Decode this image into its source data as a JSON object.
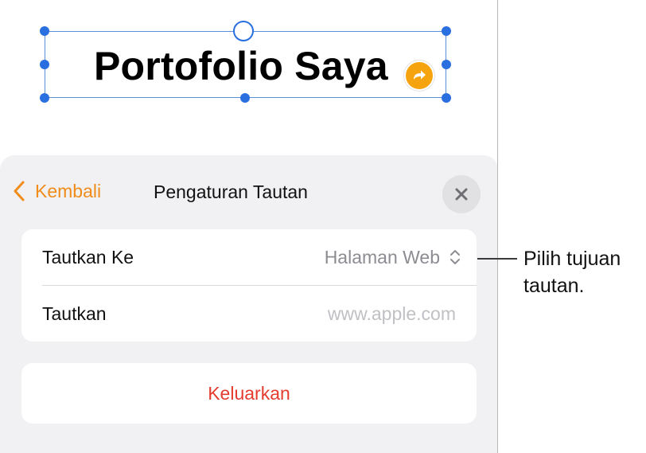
{
  "canvas": {
    "title": "Portofolio Saya",
    "link_badge_icon": "link-arrow-icon",
    "selection_color": "#2a6fe0",
    "badge_color": "#f5a30e"
  },
  "panel": {
    "back_label": "Kembali",
    "title": "Pengaturan Tautan",
    "close_icon": "close-icon",
    "accent_color": "#f08c1a",
    "rows": {
      "link_to": {
        "label": "Tautkan Ke",
        "value": "Halaman Web"
      },
      "link": {
        "label": "Tautkan",
        "value": "",
        "placeholder": "www.apple.com"
      }
    },
    "remove_label": "Keluarkan",
    "remove_color": "#e53b2f"
  },
  "callout": {
    "text": "Pilih tujuan tautan."
  }
}
